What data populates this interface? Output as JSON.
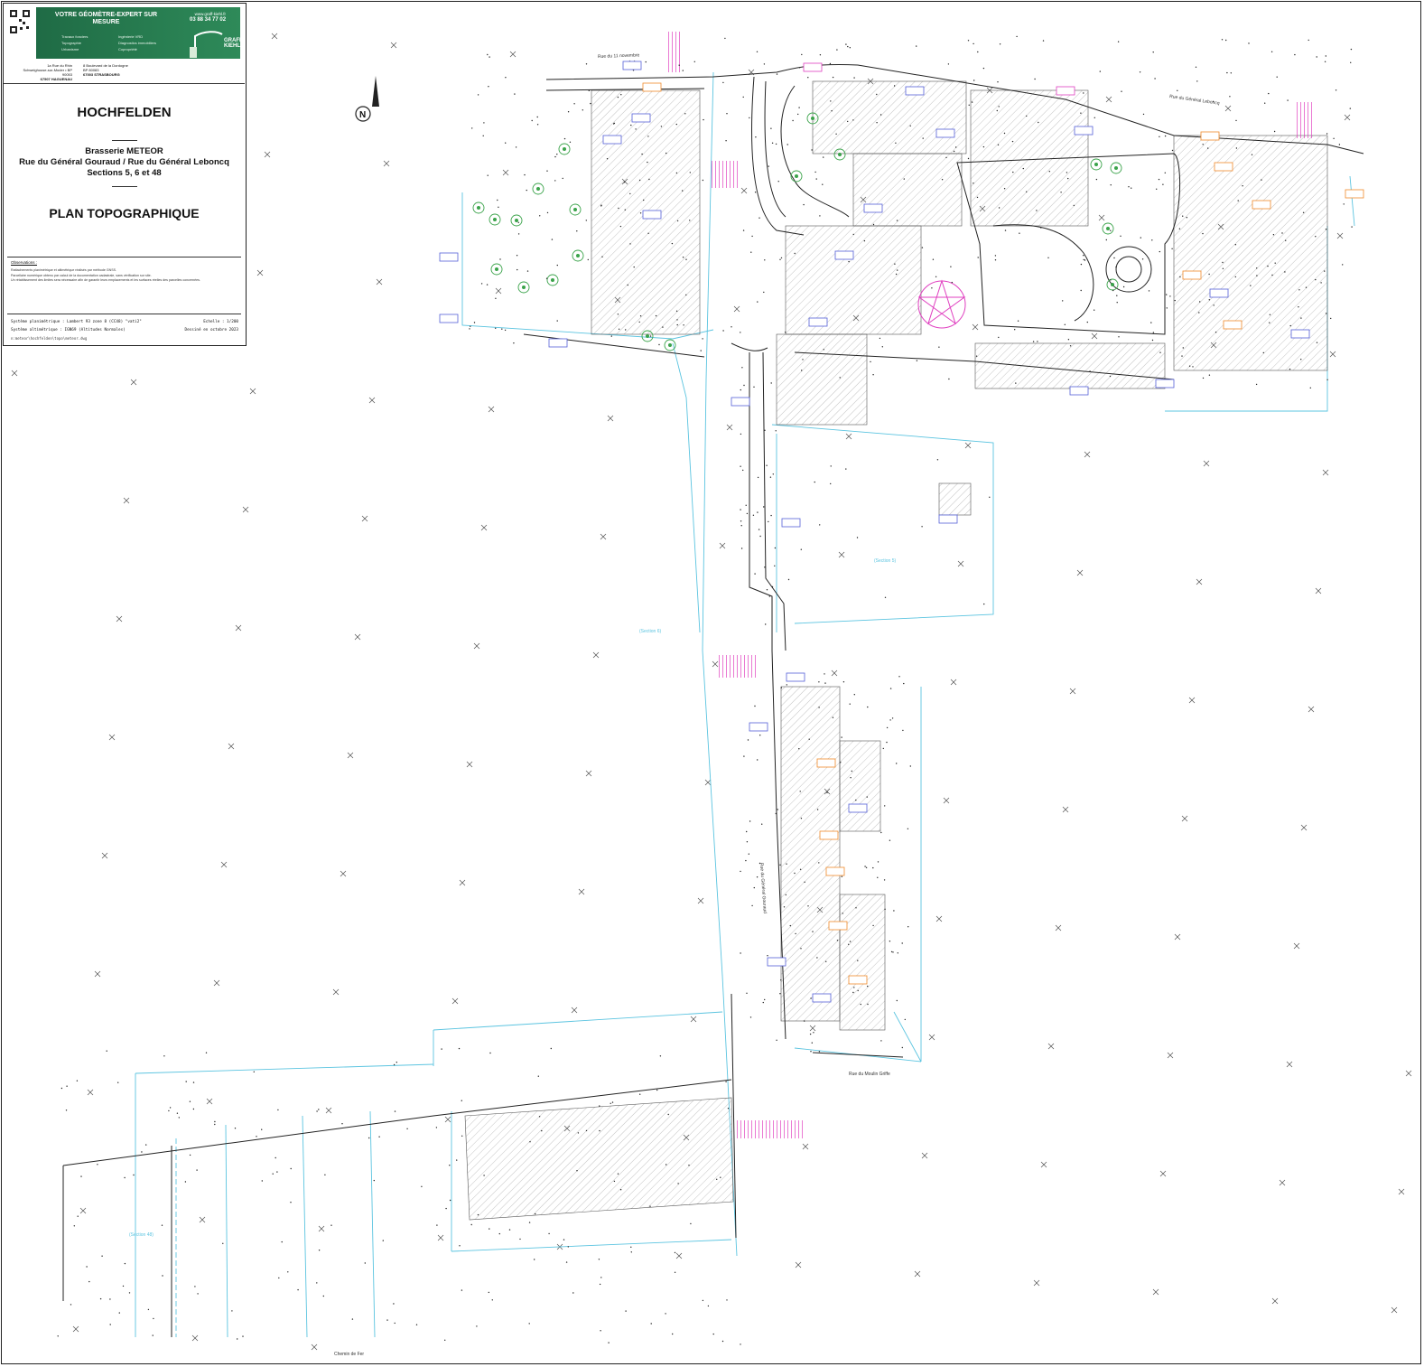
{
  "title_block": {
    "banner_title": "VOTRE GÉOMÈTRE-EXPERT SUR MESURE",
    "services": [
      "Travaux fonciers",
      "Topographie",
      "Urbanisme",
      "Ingénierie VRD",
      "Diagnostics immobiliers",
      "Copropriété"
    ],
    "website": "www.graff-kiehl.fr",
    "phone": "03 88 34 77 02",
    "firm_logo": "GRAFF KIEHL",
    "office_haguenau": [
      "1a Rue du Rhin",
      "Schweighouse-sur-Moder • BP 90053",
      "67507 HAGUENAU"
    ],
    "office_strasbourg": [
      "8 Boulevard de la Dordogne",
      "BP 80083",
      "67003 STRASBOURG"
    ],
    "city": "HOCHFELDEN",
    "project_name": "Brasserie METEOR",
    "project_streets": "Rue du Général Gouraud / Rue du Général Leboncq",
    "project_sections": "Sections 5, 6 et 48",
    "plan_title": "PLAN TOPOGRAPHIQUE",
    "observations_label": "Observations :",
    "observations": [
      "Rattachements planimétrique et altimétrique réalisés par méthode GNSS.",
      "Parcellaire numérique obtenu par calcul de la documentation cadastrale, sans vérification sur site.",
      "Un rétablissement des limites sera nécessaire afin de garantir leurs emplacements et les surfaces réelles des parcelles concernées."
    ],
    "system_plani": "Système planimétrique : Lambert 93 zone 8 (CC48) \"vati2\"",
    "system_alti": "Système altimétrique : IGN69 (Altitudes Normales)",
    "scale": "Echelle : 1/200",
    "drawn": "Dessiné en octobre 2023",
    "file_path": "n:meteor\\hochfelden\\topo\\meteor.dwg"
  },
  "north_label": "N",
  "street_labels": {
    "rue_11_novembre": "Rue du 11 novembre",
    "rue_leboncq": "Rue du Général Leboncq",
    "rue_gouraud": "Rue du Général Gouraud",
    "rue_moulin": "Rue du Moulin Griffe",
    "chemin_fer": "Chemin de Fer"
  },
  "section_labels": [
    "(Section 5)",
    "(Section 6)",
    "(Section 48)"
  ],
  "icon_names": {
    "north_arrow": "north-arrow-icon",
    "tree": "tree-icon",
    "grid_cross": "grid-cross-icon",
    "qr_code": "qr-code-icon",
    "compass_star": "pentagram-icon"
  },
  "colors": {
    "brand_green": "#1f6b45",
    "parcel_cyan": "#5bc4e0",
    "annotation_blue": "#5560d8",
    "annotation_orange": "#f08a2a",
    "highlight_magenta": "#e040c0",
    "hatch_grey": "#9a9a9a",
    "tree_green": "#3aa34a"
  }
}
